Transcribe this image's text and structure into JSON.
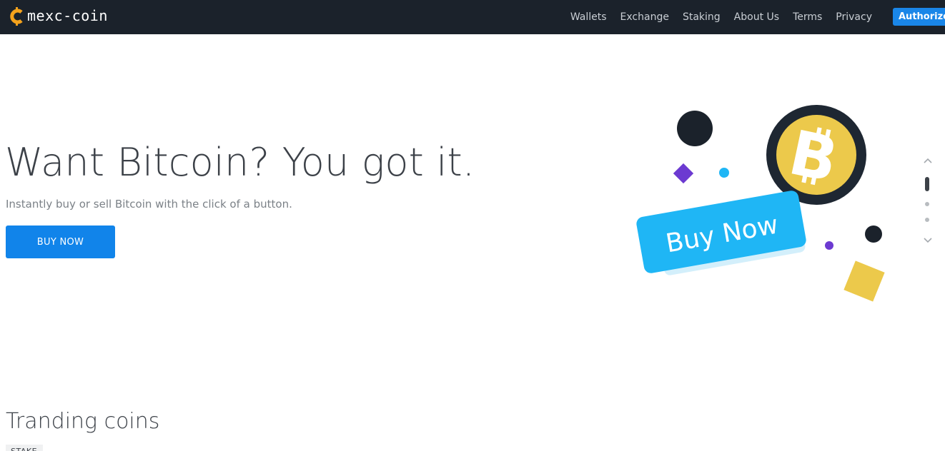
{
  "brand": {
    "name": "mexc-coin",
    "logo_icon": "coin-c-logo-icon",
    "accent": "#f4a21c"
  },
  "nav": {
    "links": [
      "Wallets",
      "Exchange",
      "Staking",
      "About Us",
      "Terms",
      "Privacy"
    ],
    "authorize_label": "Authorize"
  },
  "hero": {
    "title": "Want Bitcoin? You got it.",
    "subtitle": "Instantly buy or sell Bitcoin with the click of a button.",
    "cta_label": "BUY NOW",
    "illustration_label": "Buy Now",
    "illustration_icon": "bitcoin-coin-icon"
  },
  "carousel": {
    "slides": 3,
    "active_slide": 1
  },
  "trending": {
    "title": "Tranding coins",
    "tag": "STAKE"
  },
  "colors": {
    "navbar_bg": "#1b222b",
    "primary_button": "#1184ea",
    "coin_gold": "#ecc94b",
    "coin_ring": "#1e2732",
    "badge_cyan": "#1fb6f5",
    "purple": "#6c3ad1"
  }
}
